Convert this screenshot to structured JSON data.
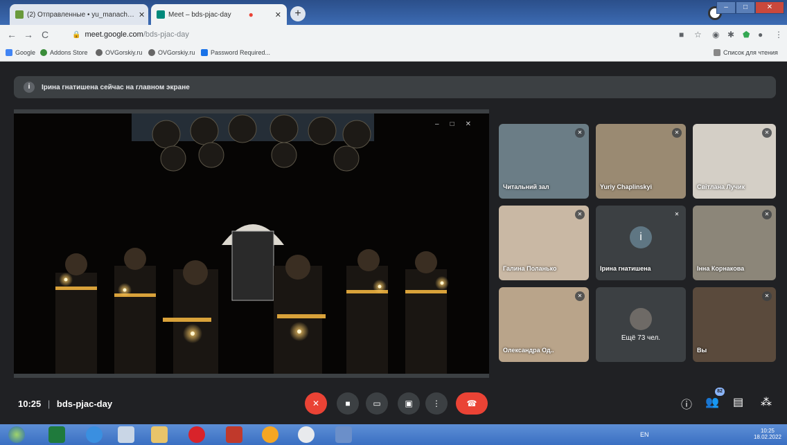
{
  "browser": {
    "tabs": [
      {
        "title": "(2) Отправленные • yu_manach…",
        "active": false
      },
      {
        "title": "Meet – bds-pjac-day",
        "active": true
      }
    ],
    "new_tab": "+",
    "address": {
      "host": "meet.google.com",
      "path": "/bds-pjac-day"
    },
    "bookmarks": [
      "Google",
      "Addons Store",
      "OVGorskiy.ru",
      "OVGorskiy.ru",
      "Password Required..."
    ],
    "reading_list": "Список для чтения"
  },
  "meet": {
    "banner": "Ірина гнатишена сейчас на главном экране",
    "banner_icon": "i",
    "time": "10:25",
    "separator": "|",
    "meeting_code": "bds-pjac-day",
    "participants_badge": "82",
    "tiles": [
      {
        "name": "Читальний зал",
        "muted": true
      },
      {
        "name": "Yuriy Chaplinskyi",
        "muted": true
      },
      {
        "name": "Світлана Лучик",
        "muted": true
      },
      {
        "name": "Галина Поланько",
        "muted": true
      },
      {
        "name": "Ірина гнатишена",
        "muted": true,
        "avatar": "і"
      },
      {
        "name": "Інна Корнакова",
        "muted": true
      },
      {
        "name": "Олександра Од..",
        "muted": true
      },
      {
        "name": "",
        "more_text": "Ещё 73 чел."
      },
      {
        "name": "Вы",
        "muted": true
      }
    ]
  },
  "taskbar": {
    "lang": "EN",
    "time": "10:25",
    "date": "18.02.2022"
  },
  "colors": {
    "accent": "#ea4335",
    "bg": "#202124",
    "tile": "#3c4043"
  }
}
